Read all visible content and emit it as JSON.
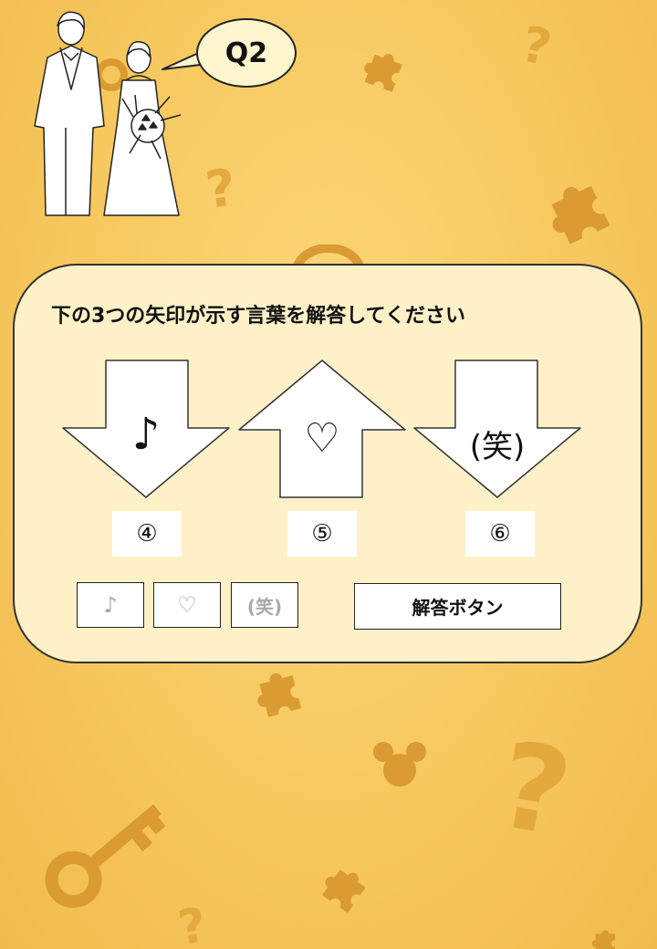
{
  "bubble": {
    "label": "Q2"
  },
  "question": {
    "text": "下の3つの矢印が示す言葉を解答してください"
  },
  "arrows": [
    {
      "direction": "down",
      "symbol": "♪"
    },
    {
      "direction": "up",
      "symbol": "♡"
    },
    {
      "direction": "down",
      "symbol": "(笑)"
    }
  ],
  "answer_boxes": [
    {
      "label": "④"
    },
    {
      "label": "⑤"
    },
    {
      "label": "⑥"
    }
  ],
  "choices": [
    {
      "label": "♪"
    },
    {
      "label": "♡"
    },
    {
      "label": "(笑)"
    }
  ],
  "submit": {
    "label": "解答ボタン"
  },
  "decorations": {
    "qmark": "?"
  },
  "colors": {
    "background": "#f6c75c",
    "panel": "#fff1c7",
    "decor": "#e3a93c",
    "choice_text": "#a9a9a9"
  },
  "icons": [
    "question-mark-icon",
    "puzzle-piece-icon",
    "key-icon",
    "mouse-head-icon"
  ]
}
